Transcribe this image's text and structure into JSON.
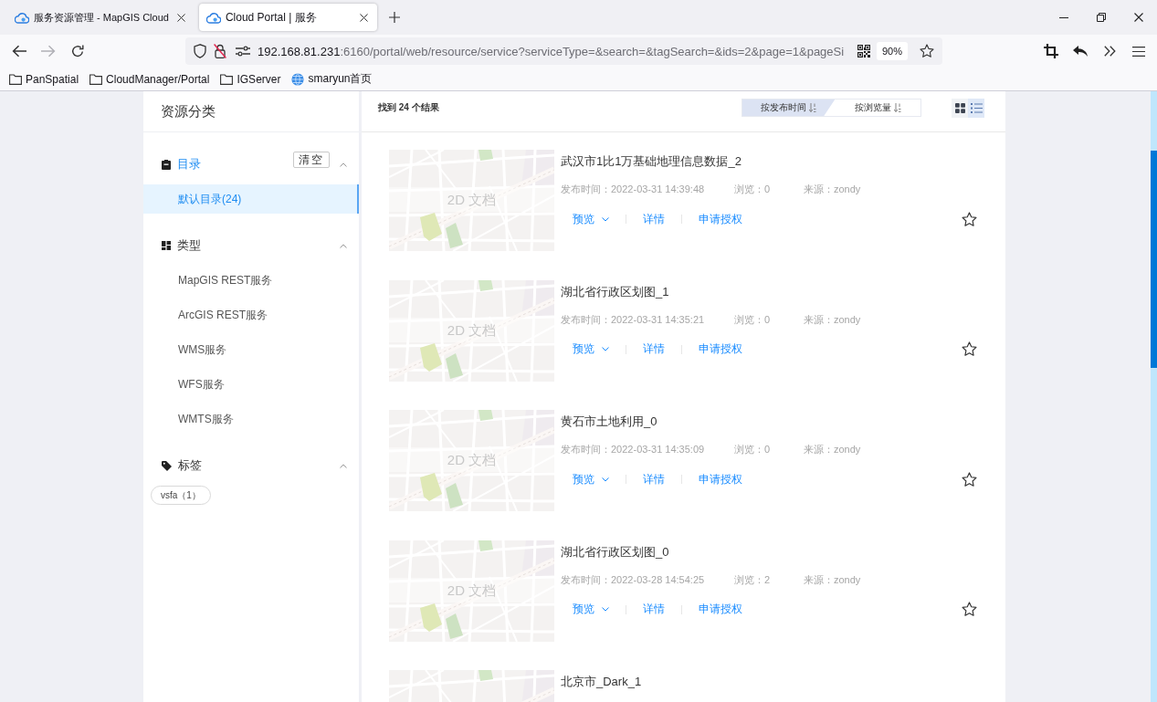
{
  "browser": {
    "tabs": [
      {
        "title": "服务资源管理 - MapGIS Cloud",
        "selected": false
      },
      {
        "title": "Cloud Portal | 服务",
        "selected": true
      }
    ],
    "address": {
      "host": "192.168.81.231",
      "path": ":6160/portal/web/resource/service?serviceType=&search=&tagSearch=&ids=2&page=1&pageSi",
      "zoom": "90%"
    },
    "bookmarks": [
      {
        "kind": "folder",
        "label": "PanSpatial"
      },
      {
        "kind": "folder",
        "label": "CloudManager/Portal"
      },
      {
        "kind": "folder",
        "label": "IGServer"
      },
      {
        "kind": "site",
        "label": "smaryun首页"
      }
    ]
  },
  "sidebar": {
    "title": "资源分类",
    "sections": [
      {
        "kind": "catalog",
        "title": "目录",
        "active": true,
        "expanded": true,
        "clear": "清空",
        "items": [
          {
            "label": "默认目录(24)",
            "selected": true
          }
        ]
      },
      {
        "kind": "type",
        "title": "类型",
        "active": false,
        "expanded": true,
        "items": [
          {
            "label": "MapGIS REST服务",
            "selected": false
          },
          {
            "label": "ArcGIS REST服务",
            "selected": false
          },
          {
            "label": "WMS服务",
            "selected": false
          },
          {
            "label": "WFS服务",
            "selected": false
          },
          {
            "label": "WMTS服务",
            "selected": false
          }
        ]
      },
      {
        "kind": "tag",
        "title": "标签",
        "active": false,
        "expanded": true,
        "tags": [
          {
            "label": "vsfa（1）",
            "selected": false
          }
        ]
      }
    ]
  },
  "results": {
    "summary": "找到 24 个结果",
    "sort": [
      {
        "label": "按发布时间",
        "selected": true
      },
      {
        "label": "按浏览量",
        "selected": false
      }
    ],
    "views": [
      {
        "kind": "grid",
        "selected": false
      },
      {
        "kind": "list",
        "selected": true
      }
    ],
    "items": [
      {
        "title": "武汉市1比1万基础地理信息数据_2",
        "thumb_label": "2D 文档",
        "published": "发布时间：2022-03-31 14:39:48",
        "views": "浏览：0",
        "source": "来源：zondy",
        "actions": [
          {
            "kind": "dropdown",
            "label": "预览"
          },
          {
            "kind": "link",
            "label": "详情"
          },
          {
            "kind": "link",
            "label": "申请授权"
          }
        ],
        "favorite": false
      },
      {
        "title": "湖北省行政区划图_1",
        "thumb_label": "2D 文档",
        "published": "发布时间：2022-03-31 14:35:21",
        "views": "浏览：0",
        "source": "来源：zondy",
        "actions": [
          {
            "kind": "dropdown",
            "label": "预览"
          },
          {
            "kind": "link",
            "label": "详情"
          },
          {
            "kind": "link",
            "label": "申请授权"
          }
        ],
        "favorite": false
      },
      {
        "title": "黄石市土地利用_0",
        "thumb_label": "2D 文档",
        "published": "发布时间：2022-03-31 14:35:09",
        "views": "浏览：0",
        "source": "来源：zondy",
        "actions": [
          {
            "kind": "dropdown",
            "label": "预览"
          },
          {
            "kind": "link",
            "label": "详情"
          },
          {
            "kind": "link",
            "label": "申请授权"
          }
        ],
        "favorite": false
      },
      {
        "title": "湖北省行政区划图_0",
        "thumb_label": "2D 文档",
        "published": "发布时间：2022-03-28 14:54:25",
        "views": "浏览：2",
        "source": "来源：zondy",
        "actions": [
          {
            "kind": "dropdown",
            "label": "预览"
          },
          {
            "kind": "link",
            "label": "详情"
          },
          {
            "kind": "link",
            "label": "申请授权"
          }
        ],
        "favorite": false
      },
      {
        "title": "北京市_Dark_1"
      }
    ]
  }
}
